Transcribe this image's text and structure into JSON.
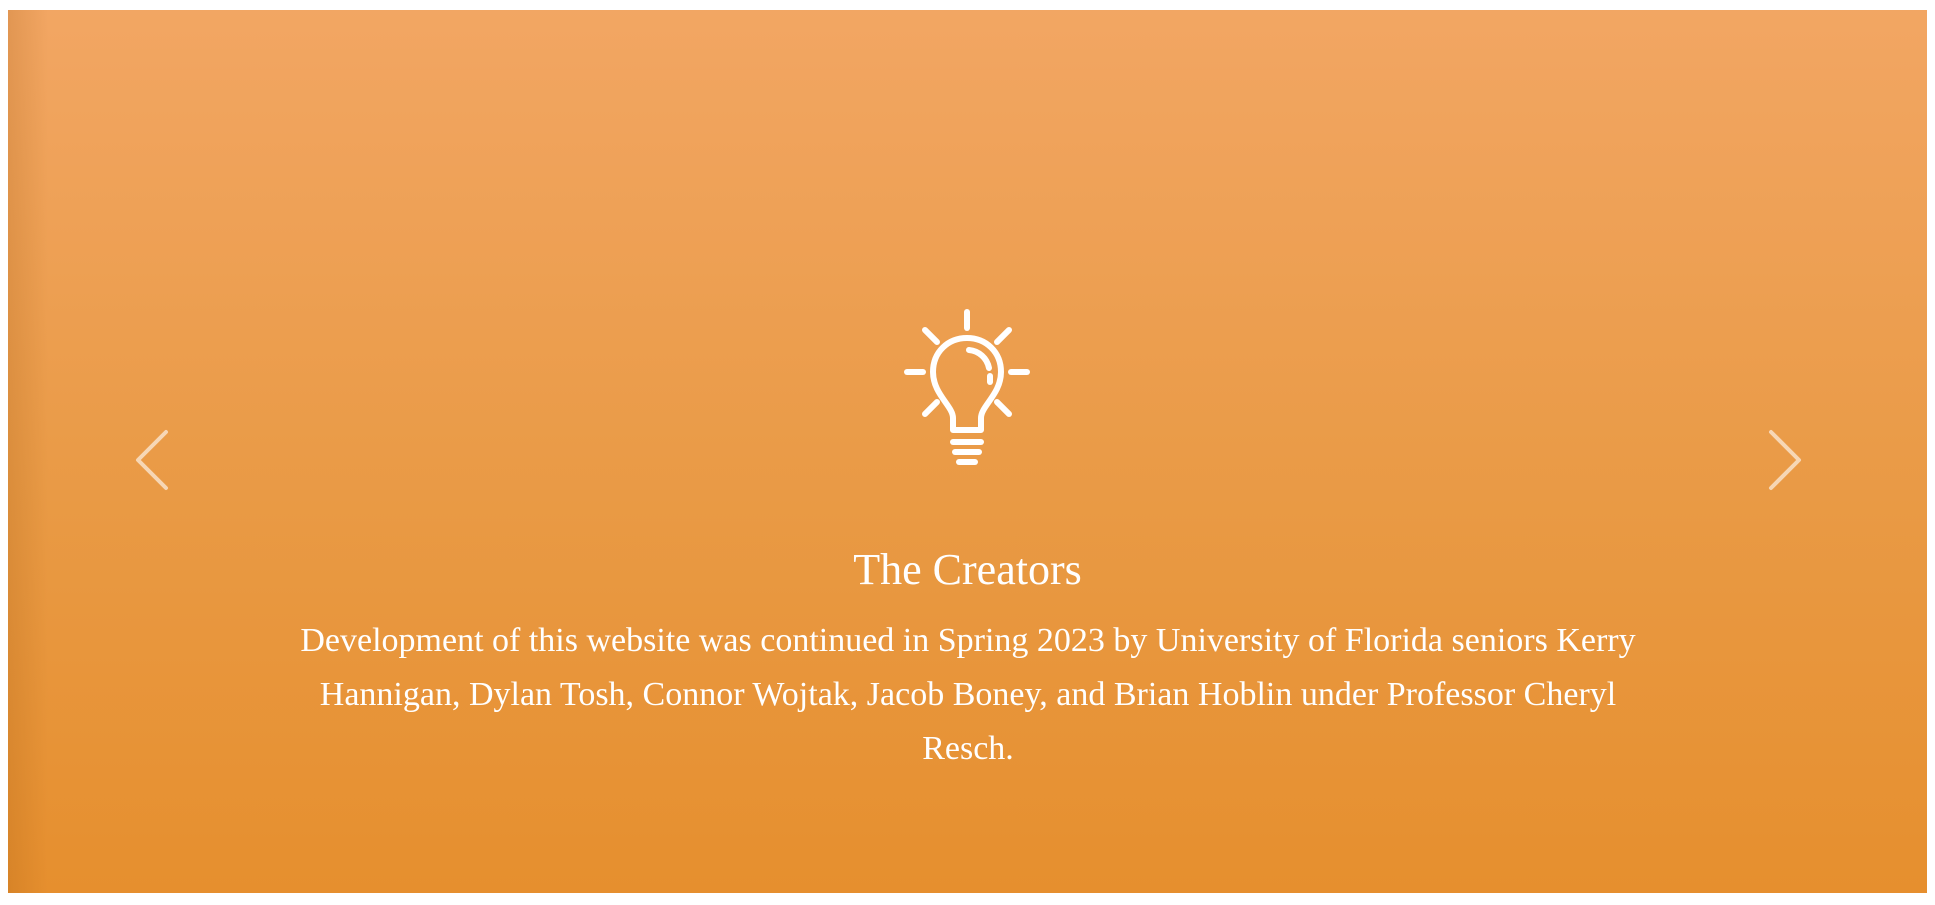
{
  "carousel": {
    "prev_icon": "chevron-left-icon",
    "next_icon": "chevron-right-icon",
    "slide": {
      "icon": "lightbulb-icon",
      "title": "The Creators",
      "body": "Development of this website was continued in Spring 2023 by University of Florida seniors Kerry Hannigan, Dylan Tosh, Connor Wojtak, Jacob Boney, and Brian Hoblin under Professor Cheryl Resch."
    }
  },
  "colors": {
    "background_top": "#f2a663",
    "background_bottom": "#e68f2e",
    "text": "#ffffff"
  }
}
